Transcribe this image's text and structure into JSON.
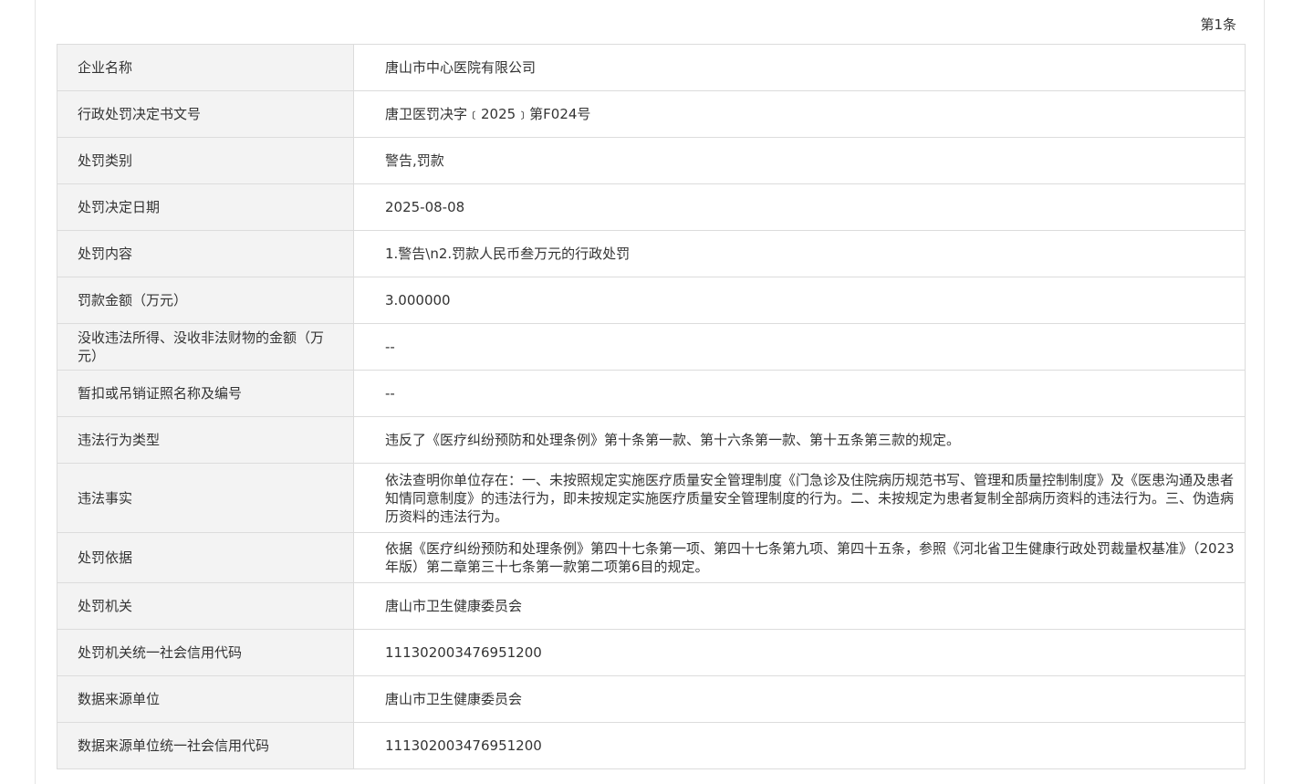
{
  "record_index": "第1条",
  "rows": [
    {
      "label": "企业名称",
      "value": "唐山市中心医院有限公司"
    },
    {
      "label": "行政处罚决定书文号",
      "value": "唐卫医罚决字﹝2025﹞第F024号"
    },
    {
      "label": "处罚类别",
      "value": "警告,罚款"
    },
    {
      "label": "处罚决定日期",
      "value": "2025-08-08"
    },
    {
      "label": "处罚内容",
      "value": "1.警告\\n2.罚款人民币叁万元的行政处罚"
    },
    {
      "label": "罚款金额（万元）",
      "value": "3.000000"
    },
    {
      "label": "没收违法所得、没收非法财物的金额（万元）",
      "value": "--"
    },
    {
      "label": "暂扣或吊销证照名称及编号",
      "value": "--"
    },
    {
      "label": "违法行为类型",
      "value": "违反了《医疗纠纷预防和处理条例》第十条第一款、第十六条第一款、第十五条第三款的规定。"
    },
    {
      "label": "违法事实",
      "value": "依法查明你单位存在：一、未按照规定实施医疗质量安全管理制度《门急诊及住院病历规范书写、管理和质量控制制度》及《医患沟通及患者知情同意制度》的违法行为，即未按规定实施医疗质量安全管理制度的行为。二、未按规定为患者复制全部病历资料的违法行为。三、伪造病历资料的违法行为。"
    },
    {
      "label": "处罚依据",
      "value": "依据《医疗纠纷预防和处理条例》第四十七条第一项、第四十七条第九项、第四十五条，参照《河北省卫生健康行政处罚裁量权基准》（2023年版）第二章第三十七条第一款第二项第6目的规定。"
    },
    {
      "label": "处罚机关",
      "value": "唐山市卫生健康委员会"
    },
    {
      "label": "处罚机关统一社会信用代码",
      "value": "111302003476951200"
    },
    {
      "label": "数据来源单位",
      "value": "唐山市卫生健康委员会"
    },
    {
      "label": "数据来源单位统一社会信用代码",
      "value": "111302003476951200"
    }
  ]
}
